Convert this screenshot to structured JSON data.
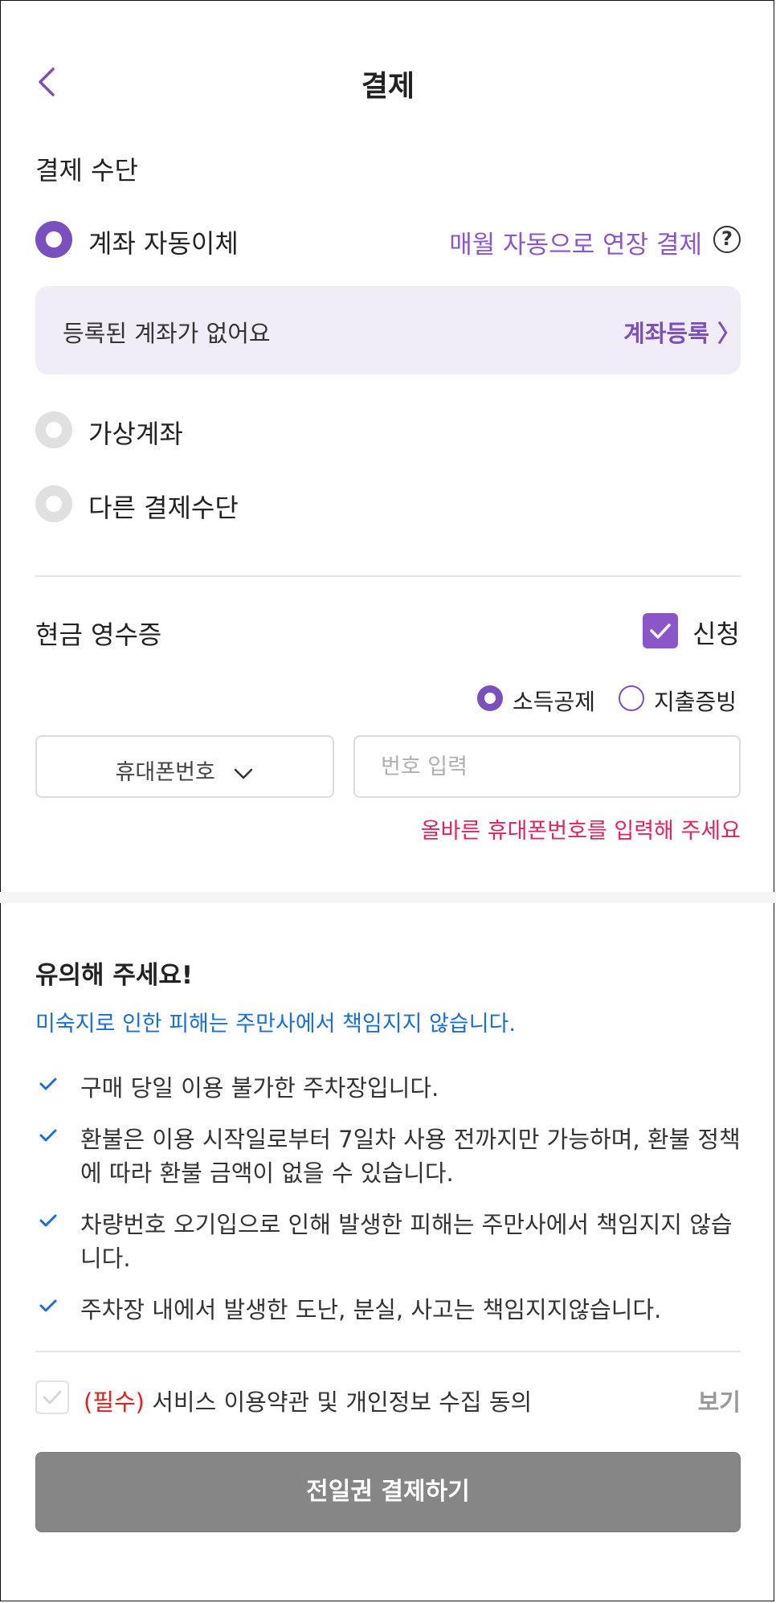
{
  "header": {
    "title": "결제"
  },
  "payment": {
    "section_title": "결제 수단",
    "options": [
      {
        "label": "계좌 자동이체",
        "selected": true
      },
      {
        "label": "가상계좌",
        "selected": false
      },
      {
        "label": "다른 결제수단",
        "selected": false
      }
    ],
    "auto_extend_label": "매월 자동으로 연장 결제",
    "account_box": {
      "empty_text": "등록된 계좌가 없어요",
      "register_label": "계좌등록 〉"
    }
  },
  "receipt": {
    "section_title": "현금 영수증",
    "apply_label": "신청",
    "apply_checked": true,
    "types": [
      {
        "label": "소득공제",
        "selected": true
      },
      {
        "label": "지출증빙",
        "selected": false
      }
    ],
    "select_value": "휴대폰번호",
    "input_placeholder": "번호 입력",
    "error": "올바른 휴대폰번호를 입력해 주세요"
  },
  "notice": {
    "title": "유의해 주세요!",
    "subtitle": "미숙지로 인한 피해는 주만사에서 책임지지 않습니다.",
    "items": [
      "구매 당일 이용 불가한 주차장입니다.",
      "환불은 이용 시작일로부터 7일차 사용 전까지만 가능하며, 환불 정책에 따라 환불 금액이 없을 수 있습니다.",
      "차량번호 오기입으로 인해 발생한 피해는 주만사에서 책임지지 않습니다.",
      "주차장 내에서 발생한 도난, 분실, 사고는 책임지지않습니다."
    ]
  },
  "agreement": {
    "required_label": "(필수)",
    "text": " 서비스 이용약관 및 개인정보 수집 동의",
    "view_label": "보기",
    "checked": false
  },
  "submit": {
    "label": "전일권 결제하기"
  },
  "colors": {
    "accent": "#7b4fbd",
    "error": "#e0245e",
    "link_blue": "#1a6fd1",
    "button_disabled": "#868686"
  },
  "icons": [
    "back-chevron-icon",
    "help-circle-icon",
    "chevron-down-icon",
    "check-icon"
  ]
}
